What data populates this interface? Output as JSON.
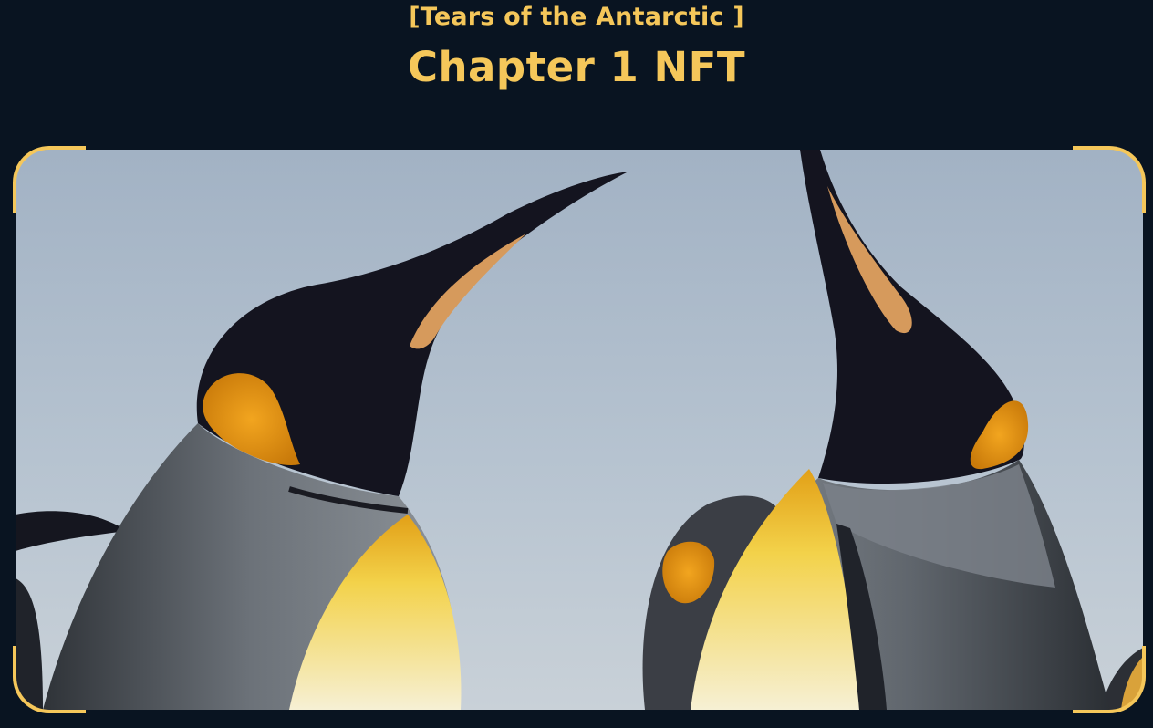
{
  "header": {
    "subtitle": "[Tears of the Antarctic ]",
    "title": "Chapter 1 NFT"
  },
  "hero": {
    "image_subject": "king-penguins-photo"
  },
  "colors": {
    "background": "#091421",
    "accent": "#F5C75A"
  }
}
